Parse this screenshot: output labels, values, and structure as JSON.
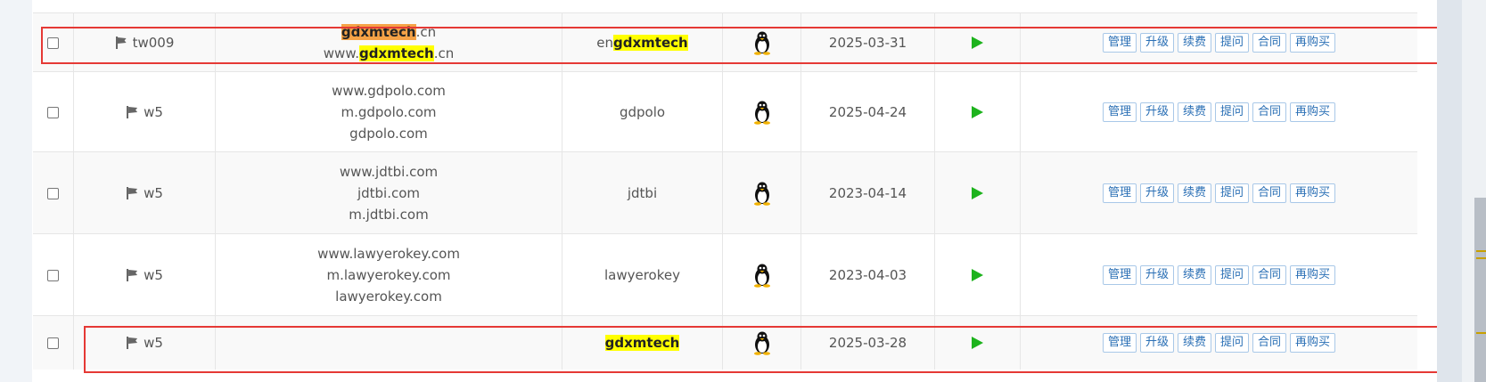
{
  "rows": [
    {
      "type": "twoline-hl",
      "owner": "tw009",
      "domain_lines": [
        {
          "pre": "",
          "hl": "gdxmtech",
          "post": ".cn",
          "hl_style": "orange"
        },
        {
          "pre": "www.",
          "hl": "gdxmtech",
          "post": ".cn",
          "hl_style": "yellow"
        }
      ],
      "name_pre": "en",
      "name_hl": "gdxmtech",
      "date": "2025-03-31"
    },
    {
      "type": "plain",
      "owner": "w5",
      "domain_lines": [
        "www.gdpolo.com",
        "m.gdpolo.com",
        "gdpolo.com"
      ],
      "name": "gdpolo",
      "date": "2025-04-24"
    },
    {
      "type": "plain",
      "owner": "w5",
      "domain_lines": [
        "www.jdtbi.com",
        "jdtbi.com",
        "m.jdtbi.com"
      ],
      "name": "jdtbi",
      "date": "2023-04-14"
    },
    {
      "type": "plain",
      "owner": "w5",
      "domain_lines": [
        "www.lawyerokey.com",
        "m.lawyerokey.com",
        "lawyerokey.com"
      ],
      "name": "lawyerokey",
      "date": "2023-04-03"
    },
    {
      "type": "name-hl",
      "owner": "w5",
      "domain_lines": [],
      "name_hl": "gdxmtech",
      "date": "2025-03-28"
    }
  ],
  "actions": [
    "管理",
    "升级",
    "续费",
    "提问",
    "合同",
    "再购买"
  ],
  "os_icon": "linux-penguin-icon",
  "status_icon": "play-icon",
  "colors": {
    "highlight_yellow": "#ffff00",
    "highlight_orange": "#f5a246",
    "annotation_red": "#e53935",
    "status_green": "#1db31d",
    "button_blue": "#2a6fb5"
  }
}
